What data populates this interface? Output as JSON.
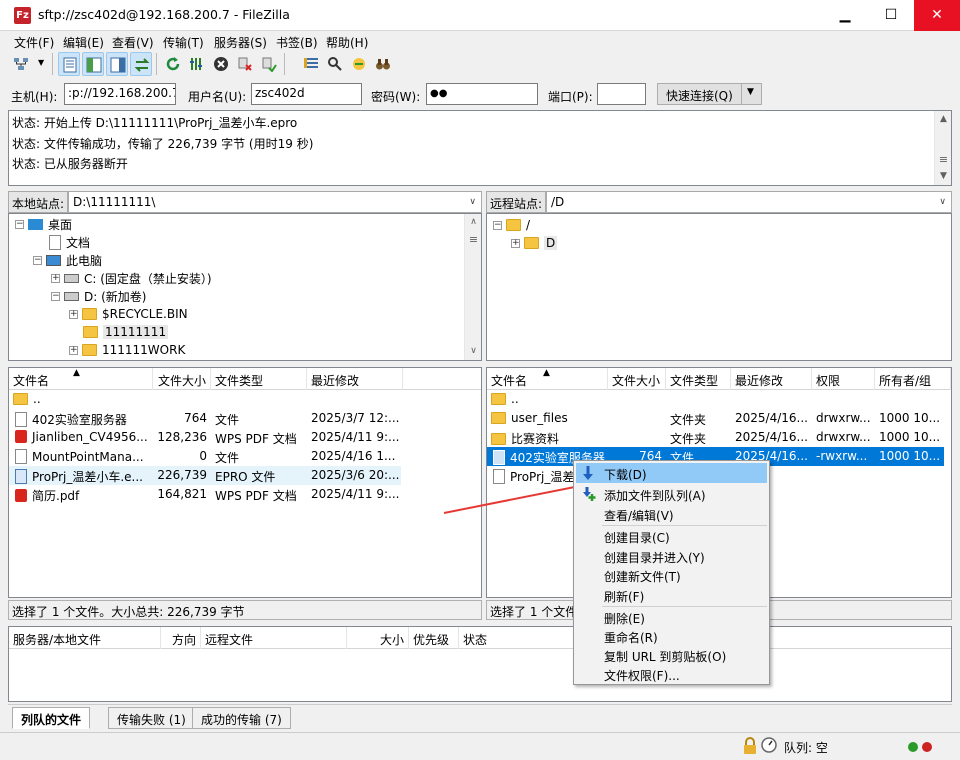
{
  "window": {
    "title": "sftp://zsc402d@192.168.200.7 - FileZilla",
    "app_icon_label": "Fz",
    "minimize_label": "▁",
    "maximize_label": "☐",
    "close_label": "✕"
  },
  "menu": [
    "文件(F)",
    "编辑(E)",
    "查看(V)",
    "传输(T)",
    "服务器(S)",
    "书签(B)",
    "帮助(H)"
  ],
  "quickconnect": {
    "host_label": "主机(H):",
    "host_value": ":p://192.168.200.7",
    "user_label": "用户名(U):",
    "user_value": "zsc402d",
    "pass_label": "密码(W):",
    "pass_value": "●●",
    "port_label": "端口(P):",
    "port_value": "",
    "connect_label": "快速连接(Q)",
    "dropdown_label": "▼"
  },
  "messages": [
    "状态: 开始上传 D:\\11111111\\ProPrj_温差小车.epro",
    "状态: 文件传输成功，传输了 226,739 字节 (用时19 秒)",
    "状态: 已从服务器断开"
  ],
  "local": {
    "site_label": "本地站点:",
    "site_path": "D:\\11111111\\",
    "tree": [
      "桌面",
      "文档",
      "此电脑",
      "C: (固定盘（禁止安装）)",
      "D: (新加卷)",
      "$RECYCLE.BIN",
      "11111111",
      "111111WORK"
    ],
    "headers": [
      "文件名",
      "文件大小",
      "文件类型",
      "最近修改"
    ],
    "files": [
      {
        "name": "..",
        "size": "",
        "type": "",
        "modified": ""
      },
      {
        "name": "402实验室服务器",
        "size": "764",
        "type": "文件",
        "modified": "2025/3/7 12:..."
      },
      {
        "name": "Jianliben_CV4956...",
        "size": "128,236",
        "type": "WPS PDF 文档",
        "modified": "2025/4/11 9:..."
      },
      {
        "name": "MountPointMana...",
        "size": "0",
        "type": "文件",
        "modified": "2025/4/16 1..."
      },
      {
        "name": "ProPrj_温差小车.e...",
        "size": "226,739",
        "type": "EPRO 文件",
        "modified": "2025/3/6 20:..."
      },
      {
        "name": "简历.pdf",
        "size": "164,821",
        "type": "WPS PDF 文档",
        "modified": "2025/4/11 9:..."
      }
    ],
    "status": "选择了 1 个文件。大小总共: 226,739 字节"
  },
  "remote": {
    "site_label": "远程站点:",
    "site_path": "/D",
    "tree": [
      "/",
      "D"
    ],
    "headers": [
      "文件名",
      "文件大小",
      "文件类型",
      "最近修改",
      "权限",
      "所有者/组"
    ],
    "files": [
      {
        "name": "..",
        "size": "",
        "type": "",
        "modified": "",
        "perms": "",
        "owner": ""
      },
      {
        "name": "user_files",
        "size": "",
        "type": "文件夹",
        "modified": "2025/4/16...",
        "perms": "drwxrw...",
        "owner": "1000 10..."
      },
      {
        "name": "比赛资料",
        "size": "",
        "type": "文件夹",
        "modified": "2025/4/16...",
        "perms": "drwxrw...",
        "owner": "1000 10..."
      },
      {
        "name": "402实验室服务器",
        "size": "764",
        "type": "文件",
        "modified": "2025/4/16...",
        "perms": "-rwxrw...",
        "owner": "1000 10..."
      },
      {
        "name": "ProPrj_温差",
        "size": "",
        "type": "",
        "modified": "",
        "perms": "",
        "owner": ""
      }
    ],
    "status": "选择了 1 个文件"
  },
  "queue": {
    "headers": [
      "服务器/本地文件",
      "方向",
      "远程文件",
      "大小",
      "优先级",
      "状态"
    ],
    "tabs": [
      "列队的文件",
      "传输失败 (1)",
      "成功的传输 (7)"
    ],
    "queue_status": "队列: 空"
  },
  "context_menu": [
    "下载(D)",
    "添加文件到队列(A)",
    "查看/编辑(V)",
    "创建目录(C)",
    "创建目录并进入(Y)",
    "创建新文件(T)",
    "刷新(F)",
    "删除(E)",
    "重命名(R)",
    "复制 URL 到剪贴板(O)",
    "文件权限(F)..."
  ],
  "colors": {
    "selection": "#0078d7",
    "menu_hover": "#91c9f7",
    "annotation_arrow": "#e53935",
    "close_button": "#e81123"
  }
}
